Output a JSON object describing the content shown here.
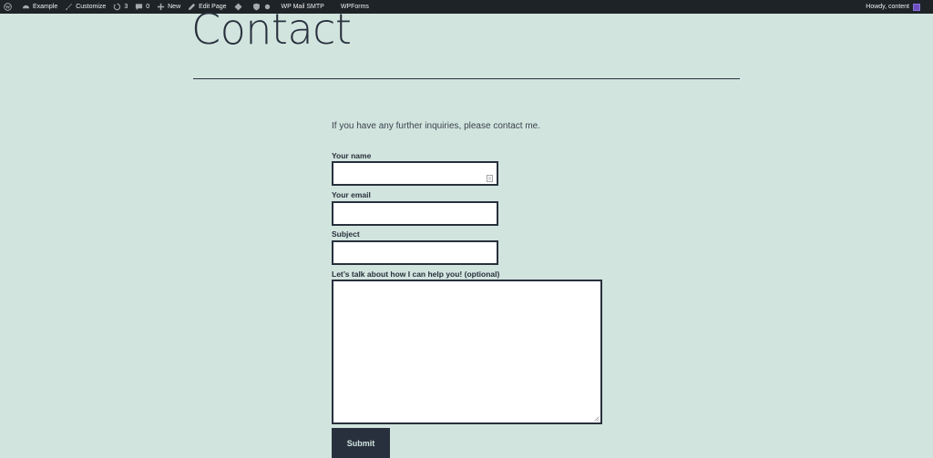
{
  "adminbar": {
    "site_name": "Example",
    "customize": "Customize",
    "updates_count": "3",
    "comments_count": "0",
    "new_label": "New",
    "edit_page": "Edit Page",
    "wp_mail_smtp": "WP Mail SMTP",
    "wpforms": "WPForms",
    "howdy": "Howdy, content"
  },
  "page": {
    "title": "Contact",
    "intro": "If you have any further inquiries, please contact me."
  },
  "form": {
    "name_label": "Your name",
    "name_value": "",
    "email_label": "Your email",
    "email_value": "",
    "subject_label": "Subject",
    "subject_value": "",
    "message_label": "Let’s talk about how I can help you! (optional)",
    "message_value": "",
    "submit_label": "Submit"
  },
  "colors": {
    "background": "#d2e4de",
    "text": "#28303d",
    "adminbar": "#1d2327"
  }
}
